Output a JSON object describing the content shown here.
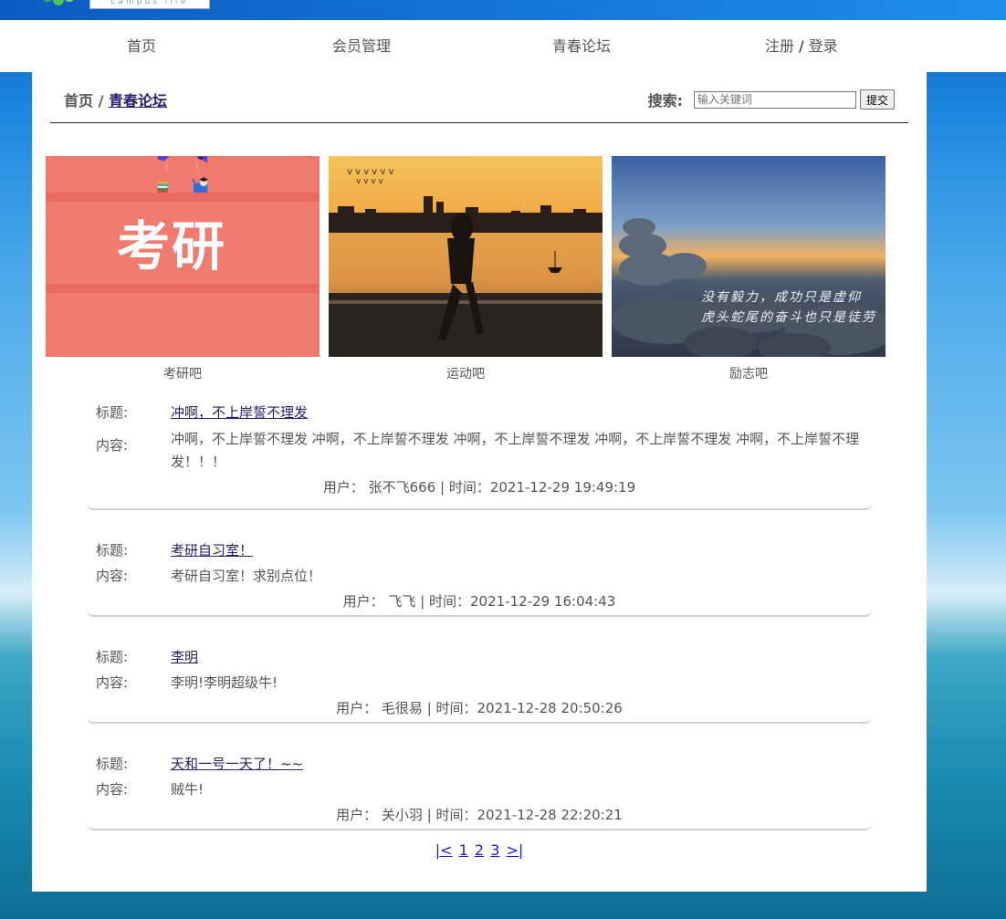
{
  "header": {
    "logo_tagline": "campus life",
    "nav": [
      "首页",
      "会员管理",
      "青春论坛"
    ],
    "auth": {
      "register": "注册",
      "sep": "/",
      "login": "登录"
    }
  },
  "breadcrumb": {
    "home": "首页",
    "sep": "/",
    "current": "青春论坛"
  },
  "search": {
    "label": "搜索:",
    "placeholder": "输入关键词",
    "button": "提交"
  },
  "categories": [
    {
      "caption": "考研吧",
      "image_text": "考研",
      "icon": "exam-banner-image"
    },
    {
      "caption": "运动吧",
      "icon": "runner-sunset-image"
    },
    {
      "caption": "励志吧",
      "image_text": [
        "没有毅力，成功只是虚仰",
        "虎头蛇尾的奋斗也只是徒劳"
      ],
      "icon": "stones-sunset-image"
    }
  ],
  "labels": {
    "title": "标题:",
    "content": "内容:"
  },
  "posts": [
    {
      "title": "冲啊，不上岸誓不理发",
      "content": "冲啊，不上岸誓不理发 冲啊，不上岸誓不理发 冲啊，不上岸誓不理发 冲啊，不上岸誓不理发 冲啊，不上岸誓不理发！！！",
      "meta": "用户：  张不飞666 | 时间：2021-12-29 19:49:19"
    },
    {
      "title": "考研自习室！",
      "content": "考研自习室！求别点位！",
      "meta": "用户：  飞飞 | 时间：2021-12-29 16:04:43"
    },
    {
      "title": "李明",
      "content": "李明!李明超级牛!",
      "meta": "用户：  毛很易 | 时间：2021-12-28 20:50:26"
    },
    {
      "title": "天和一号一天了！~~",
      "content": "贼牛!",
      "meta": "用户：  关小羽 | 时间：2021-12-28 22:20:21"
    }
  ],
  "pagination": {
    "first": "|<",
    "pages": [
      "1",
      "2",
      "3"
    ],
    "last": ">|"
  }
}
